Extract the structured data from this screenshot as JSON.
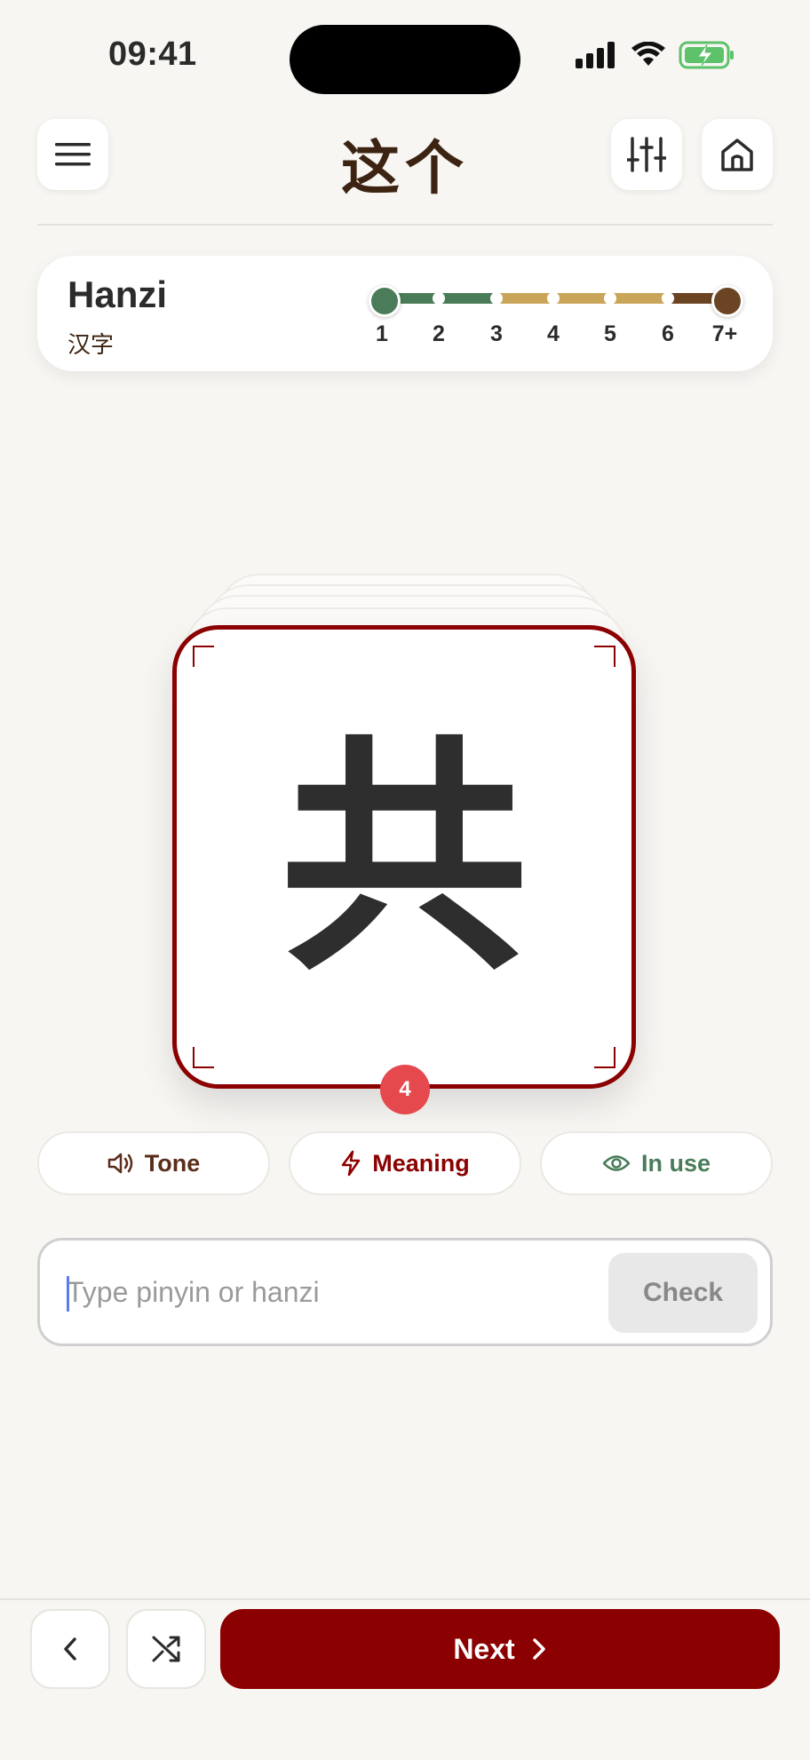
{
  "status_bar": {
    "time": "09:41"
  },
  "header": {
    "logo_text": "这个",
    "menu_icon": "hamburger-icon",
    "settings_icon": "sliders-icon",
    "home_icon": "home-icon"
  },
  "level_selector": {
    "title": "Hanzi",
    "subtitle": "汉字",
    "levels": [
      "1",
      "2",
      "3",
      "4",
      "5",
      "6",
      "7+"
    ],
    "selected_range": [
      "1",
      "7+"
    ],
    "colors": {
      "green": "#4a7c59",
      "gold": "#c9a55a",
      "brown": "#6b4423"
    }
  },
  "flashcard": {
    "character": "共",
    "stack_count": "4",
    "border_color": "#8b0000"
  },
  "hints": [
    {
      "label": "Tone",
      "icon": "speaker-icon",
      "color": "#5a2d1a"
    },
    {
      "label": "Meaning",
      "icon": "lightning-icon",
      "color": "#8b0000"
    },
    {
      "label": "In use",
      "icon": "eye-icon",
      "color": "#4a7c59"
    }
  ],
  "answer": {
    "placeholder": "Type pinyin or hanzi",
    "value": "",
    "check_label": "Check"
  },
  "bottom_bar": {
    "back_icon": "chevron-left-icon",
    "shuffle_icon": "shuffle-icon",
    "next_label": "Next"
  }
}
